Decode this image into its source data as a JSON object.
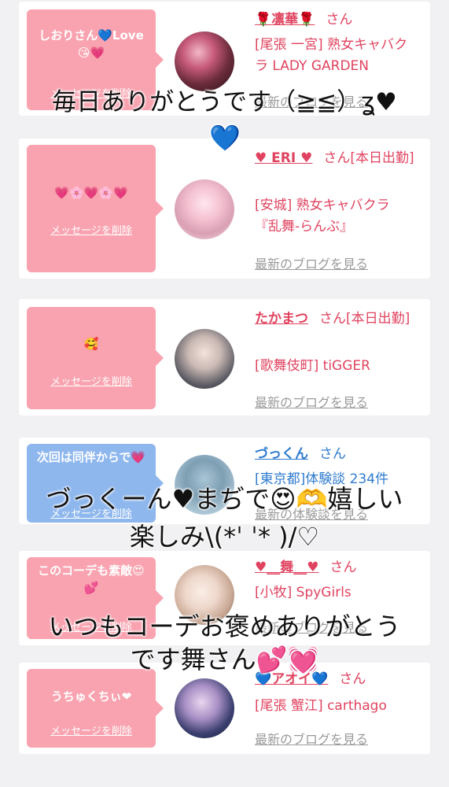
{
  "cards": [
    {
      "bubble_text": "しおりさん💙Love😘💗",
      "delete_label": "メッセージを削除",
      "name": "🌹凛華🌹",
      "san": "さん",
      "shop": "[尾張 一宮] 熟女キャバクラ LADY GARDEN",
      "blog": "最新のブログを見る"
    },
    {
      "bubble_text": "💗🌸💗🌸💗",
      "delete_label": "メッセージを削除",
      "name": "♥ ERI ♥",
      "san": "さん[本日出勤]",
      "shop": "[安城] 熟女キャバクラ『乱舞-らんぶ』",
      "blog": "最新のブログを見る"
    },
    {
      "bubble_text": "🥰",
      "delete_label": "メッセージを削除",
      "name": "たかまつ",
      "san": "さん[本日出勤]",
      "shop": "[歌舞伎町] tiGGER",
      "blog": "最新のブログを見る"
    },
    {
      "bubble_text": "次回は同伴からで💗",
      "delete_label": "メッセージを削除",
      "name": "づっくん",
      "san": "さん",
      "shop": "[東京都]体験談 234件",
      "blog": "最新の体験談を見る"
    },
    {
      "bubble_text": "このコーデも素敵😍💕",
      "delete_label": "メッセージを削除",
      "name": "♥__舞__♥",
      "san": "さん",
      "shop": "[小牧] SpyGirls",
      "blog": "最新のブログを見る"
    },
    {
      "bubble_text": "うちゅくちぃ❤",
      "delete_label": "メッセージを削除",
      "name": "💙アオイ💙",
      "san": "さん",
      "shop": "[尾張 蟹江] carthago",
      "blog": "最新のブログを見る"
    }
  ],
  "overlays": {
    "line1": "毎日ありがとうです（≧≦）ʓ♥",
    "line1b": "💙",
    "line2": "づっくーん♥まぢで😍🫶嬉しい",
    "line3": "楽しみ\\(*ˈ ˈ* )/♡",
    "line4": "いつもコーデお褒めありがとう",
    "line5": "です舞さん💕💓"
  },
  "colors": {
    "pink_bubble": "#f9a3b0",
    "blue_bubble": "#8eb7ee",
    "pink_text": "#e0435f",
    "blue_text": "#2f7bcf"
  }
}
